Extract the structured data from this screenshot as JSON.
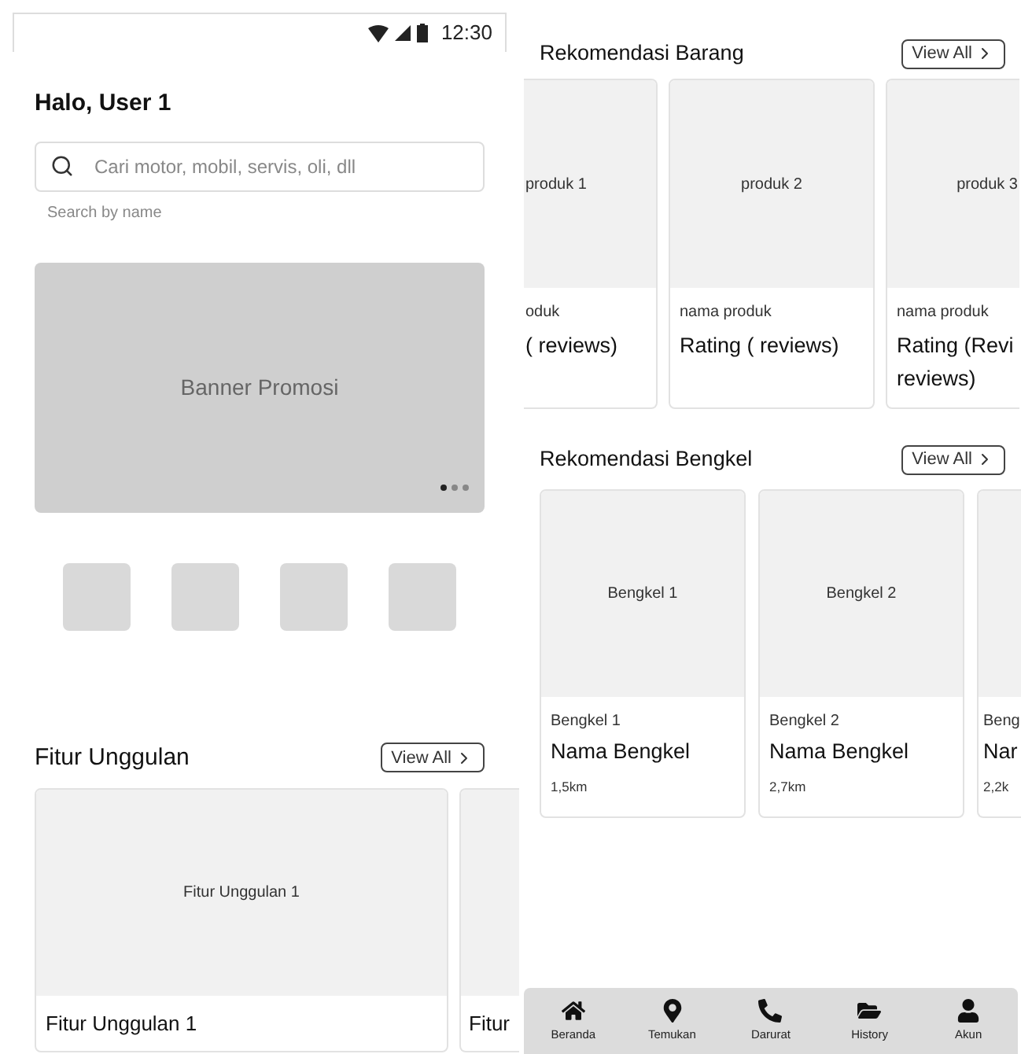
{
  "left_screen": {
    "status_bar": {
      "time": "12:30"
    },
    "greeting": "Halo, User 1",
    "search": {
      "placeholder": "Cari motor, mobil, servis, oli, dll",
      "helper": "Search by name"
    },
    "banner": {
      "label": "Banner Promosi",
      "dots": [
        {
          "selected": true
        },
        {
          "selected": false
        },
        {
          "selected": false
        }
      ]
    },
    "shortcuts": [
      {
        "kind": "placeholder"
      },
      {
        "kind": "placeholder"
      },
      {
        "kind": "placeholder"
      },
      {
        "kind": "placeholder"
      }
    ],
    "featured": {
      "title": "Fitur Unggulan",
      "view_all": "View All",
      "cards": [
        {
          "image_label": "Fitur Unggulan 1",
          "title": "Fitur Unggulan 1",
          "kind": "full"
        },
        {
          "title": "Fitur",
          "kind": "clipped"
        }
      ]
    }
  },
  "right_screen": {
    "products": {
      "title": "Rekomendasi Barang",
      "view_all": "View All",
      "cards": [
        {
          "image_label": "produk 1",
          "name": "oduk",
          "rating": "( reviews)",
          "kind": "clipped_left"
        },
        {
          "image_label": "produk 2",
          "name": "nama produk",
          "rating": "Rating ( reviews)",
          "kind": "full"
        },
        {
          "image_label": "produk 3",
          "name": "nama produk",
          "rating": "Rating (Revi\nreviews)",
          "kind": "clipped_right"
        }
      ]
    },
    "workshops": {
      "title": "Rekomendasi Bengkel",
      "view_all": "View All",
      "cards": [
        {
          "image_label": "Bengkel 1",
          "label": "Bengkel 1",
          "name": "Nama Bengkel",
          "distance": "1,5km",
          "kind": "full"
        },
        {
          "image_label": "Bengkel 2",
          "label": "Bengkel 2",
          "name": "Nama Bengkel",
          "distance": "2,7km",
          "kind": "full"
        },
        {
          "label": "Beng",
          "name": "Nar",
          "distance": "2,2k",
          "kind": "clipped"
        }
      ]
    },
    "bottom_nav": [
      "Beranda",
      "Temukan",
      "Darurat",
      "History",
      "Akun"
    ]
  }
}
